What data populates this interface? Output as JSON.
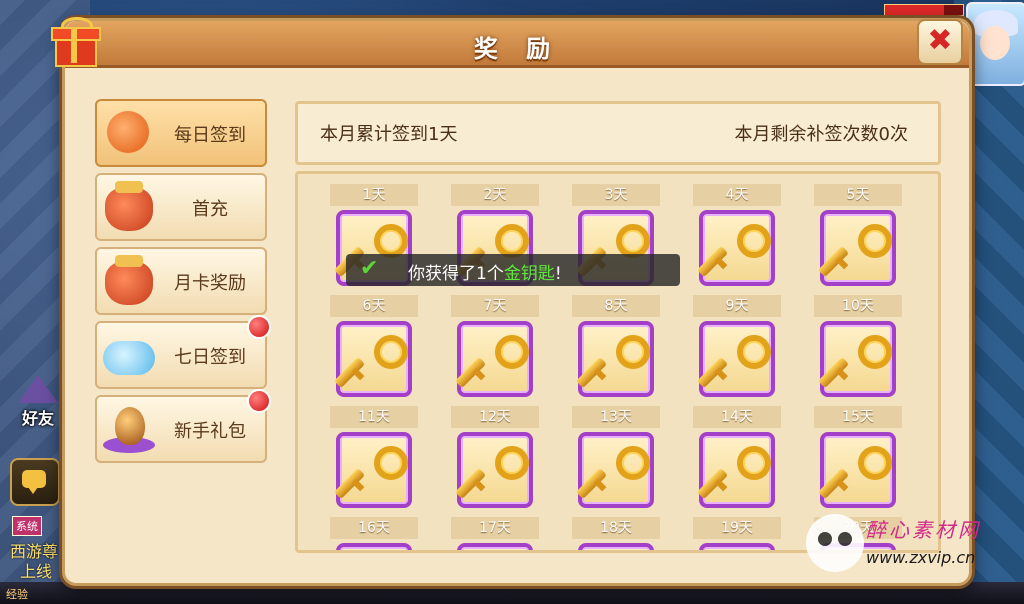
{
  "dialog": {
    "title": "奖 励",
    "close": "✖"
  },
  "tabs": [
    {
      "label": "每日签到",
      "icon": "lantern-icon",
      "active": true,
      "dot": false
    },
    {
      "label": "首充",
      "icon": "money-bag-icon",
      "active": false,
      "dot": false
    },
    {
      "label": "月卡奖励",
      "icon": "money-bag-icon",
      "active": false,
      "dot": false
    },
    {
      "label": "七日签到",
      "icon": "cloud-treasure-icon",
      "active": false,
      "dot": true
    },
    {
      "label": "新手礼包",
      "icon": "egg-gift-icon",
      "active": false,
      "dot": true
    }
  ],
  "info": {
    "left": "本月累计签到1天",
    "right": "本月剩余补签次数0次"
  },
  "days": [
    "1天",
    "2天",
    "3天",
    "4天",
    "5天",
    "6天",
    "7天",
    "8天",
    "9天",
    "10天",
    "11天",
    "12天",
    "13天",
    "14天",
    "15天",
    "16天",
    "17天",
    "18天",
    "19天",
    "20天"
  ],
  "toast": {
    "prefix": "你获得了1个",
    "item": "金钥匙",
    "suffix": "!"
  },
  "hud": {
    "friend": "好友",
    "system_badge": "系统",
    "system_line1": "西游尊",
    "system_line2": "上线",
    "exp_label": "经验",
    "hp_fraction": 0.75
  },
  "watermark": {
    "name": "醉心素材网",
    "url": "www.zxvip.cn"
  },
  "colors": {
    "toast_highlight": "#5fe83a",
    "frame_purple": "#a340c8",
    "close_red": "#d62626"
  }
}
